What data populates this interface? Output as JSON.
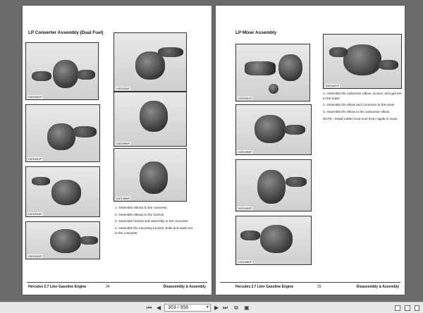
{
  "left_page": {
    "title": "LP Converter Assembly (Dual Fuel)",
    "photos": [
      {
        "label": "IOED092P"
      },
      {
        "label": "IOED094P"
      },
      {
        "label": "IOED091P"
      },
      {
        "label": "IOED095P"
      },
      {
        "label": "IOED093P"
      },
      {
        "label": "IOED096P"
      },
      {
        "label": "IOED093P"
      }
    ],
    "steps": [
      "1. Assemble elbows to the converter.",
      "2. Assemble elbows to the fuelock.",
      "3. Assemble fuelock sub-assembly to the converter.",
      "4. Assemble the mounting bracket, bolts and wash-ers to the converter."
    ],
    "footer_left": "Hercules 2.7 Liter Gasoline Engine",
    "footer_page": "24",
    "footer_right": "Disassembly & Assembly"
  },
  "right_page": {
    "title": "LP Mixer Assembly",
    "photos": [
      {
        "label": "IOED097P"
      },
      {
        "label": "IOED091P"
      },
      {
        "label": "IOED098P"
      },
      {
        "label": "IOED099P"
      },
      {
        "label": "IOED090P"
      }
    ],
    "steps": [
      "1. Assemble the carburetor elbow, screws, and gas-ket to the mixer.",
      "2. Assemble the elbow and connector to the mixer.",
      "3. Assemble the elbow to the carburetor elbow.",
      "NOTE : Install rubber boot over hose nipple in mixer."
    ],
    "footer_left": "Hercules 2.7 Liter Gasoline Engine",
    "footer_page": "25",
    "footer_right": "Disassembly & Assembly"
  },
  "toolbar": {
    "first_icon": "first-page-icon",
    "first_glyph": "⏮",
    "prev_glyph": "◀",
    "page_display": "303 / 958",
    "dropdown_glyph": "▾",
    "next_glyph": "▶",
    "last_glyph": "⏭",
    "copy_glyph": "⧉",
    "fit_glyph": "▣"
  }
}
